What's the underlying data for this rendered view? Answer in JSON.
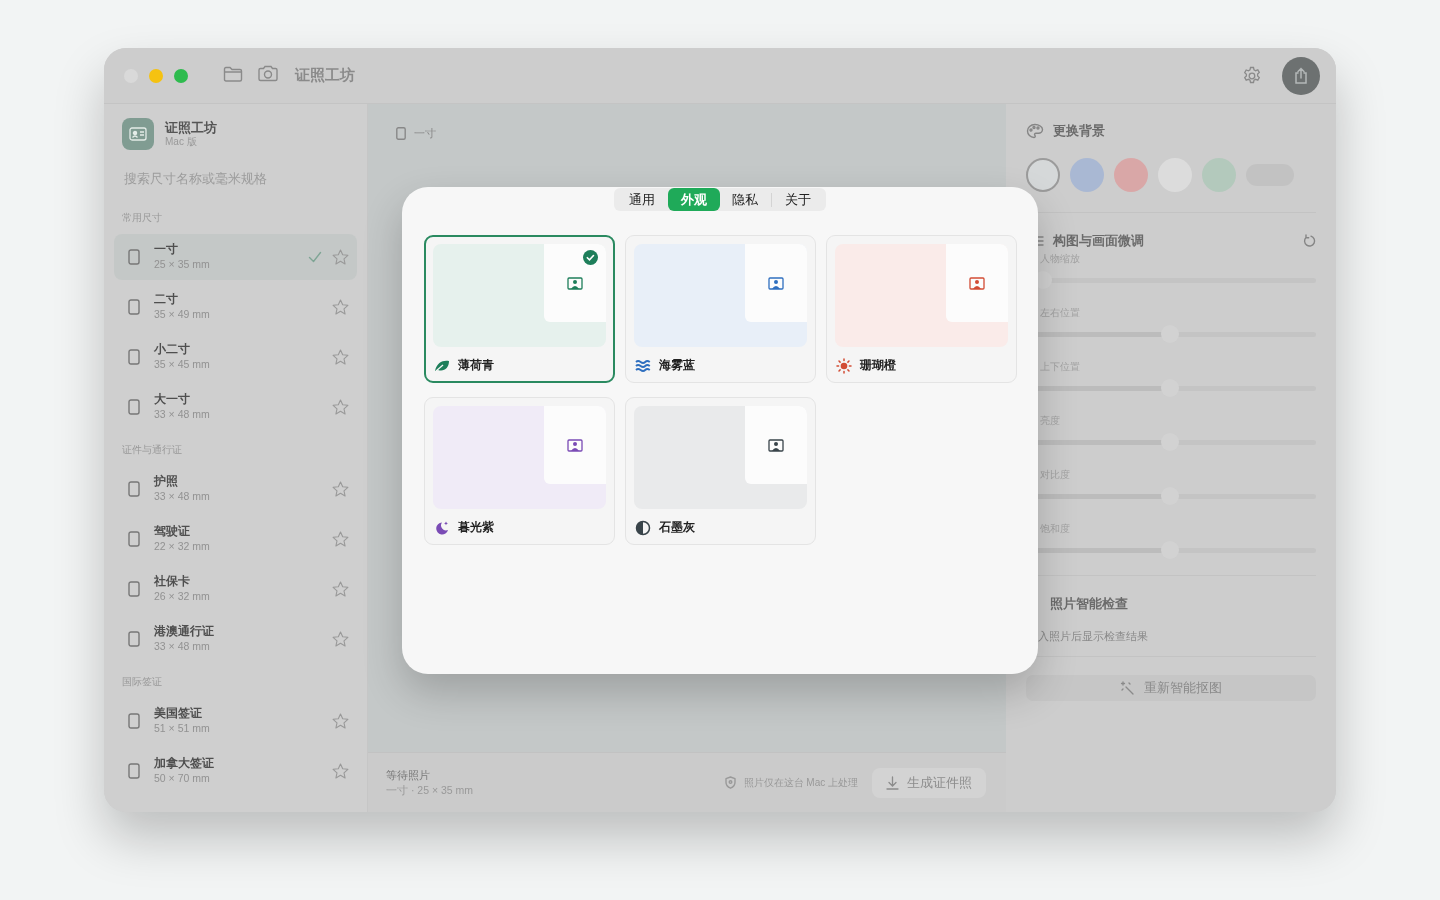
{
  "window": {
    "title": "证照工坊"
  },
  "sidebar": {
    "app_name": "证照工坊",
    "app_edition": "Mac 版",
    "search": {
      "placeholder": "搜索尺寸名称或毫米规格"
    },
    "sections": [
      {
        "title": "常用尺寸",
        "items": [
          {
            "name": "一寸",
            "size": "25 × 35 mm",
            "selected": true
          },
          {
            "name": "二寸",
            "size": "35 × 49 mm",
            "selected": false
          },
          {
            "name": "小二寸",
            "size": "35 × 45 mm",
            "selected": false
          },
          {
            "name": "大一寸",
            "size": "33 × 48 mm",
            "selected": false
          }
        ]
      },
      {
        "title": "证件与通行证",
        "items": [
          {
            "name": "护照",
            "size": "33 × 48 mm",
            "selected": false
          },
          {
            "name": "驾驶证",
            "size": "22 × 32 mm",
            "selected": false
          },
          {
            "name": "社保卡",
            "size": "26 × 32 mm",
            "selected": false
          },
          {
            "name": "港澳通行证",
            "size": "33 × 48 mm",
            "selected": false
          }
        ]
      },
      {
        "title": "国际签证",
        "items": [
          {
            "name": "美国签证",
            "size": "51 × 51 mm",
            "selected": false
          },
          {
            "name": "加拿大签证",
            "size": "50 × 70 mm",
            "selected": false
          }
        ]
      }
    ]
  },
  "main": {
    "current_size": "一寸",
    "status_title": "等待照片",
    "status_detail": "一寸 · 25 × 35 mm",
    "privacy_note": "照片仅在这台 Mac 上处理",
    "generate_button": {
      "label": "生成证件照",
      "disabled": true
    }
  },
  "settings_dialog": {
    "tabs": [
      {
        "label": "通用",
        "selected": false
      },
      {
        "label": "外观",
        "selected": true
      },
      {
        "label": "隐私",
        "selected": false
      },
      {
        "label": "关于",
        "selected": false
      }
    ],
    "themes": [
      {
        "name": "薄荷青",
        "kind": "leaf",
        "color": "#1e7e5a",
        "selected": true
      },
      {
        "name": "海雾蓝",
        "kind": "waves",
        "color": "#2f6fbf",
        "selected": false
      },
      {
        "name": "珊瑚橙",
        "kind": "sun",
        "color": "#d24c34",
        "selected": false
      },
      {
        "name": "暮光紫",
        "kind": "moon",
        "color": "#7a4bb5",
        "selected": false
      },
      {
        "name": "石墨灰",
        "kind": "contrast",
        "color": "#39444a",
        "selected": false
      }
    ]
  },
  "right_panel": {
    "background": {
      "title": "更换背景",
      "swatches": [
        {
          "kind": "circle",
          "color": "#d5d8d9",
          "selected": true
        },
        {
          "kind": "circle",
          "color": "#a9b8d3",
          "selected": false
        },
        {
          "kind": "circle",
          "color": "#d9a7a7",
          "selected": false
        },
        {
          "kind": "circle",
          "color": "#dcdcdc",
          "selected": false
        },
        {
          "kind": "circle",
          "color": "#b3c9bc",
          "selected": false
        },
        {
          "kind": "pill",
          "color": "#c2c2c2",
          "selected": false
        }
      ]
    },
    "adjust": {
      "title": "构图与画面微调",
      "sliders": [
        {
          "label": "人物缩放",
          "level": 0
        },
        {
          "label": "左右位置",
          "level": 0.48
        },
        {
          "label": "上下位置",
          "level": 0.48
        },
        {
          "label": "亮度",
          "level": 0.48
        },
        {
          "label": "对比度",
          "level": 0.48
        },
        {
          "label": "饱和度",
          "level": 0.48
        }
      ]
    },
    "check": {
      "title": "照片智能检查",
      "note": "入照片后显示检查结果"
    },
    "rematte_button": {
      "label": "重新智能抠图",
      "disabled": true
    }
  }
}
